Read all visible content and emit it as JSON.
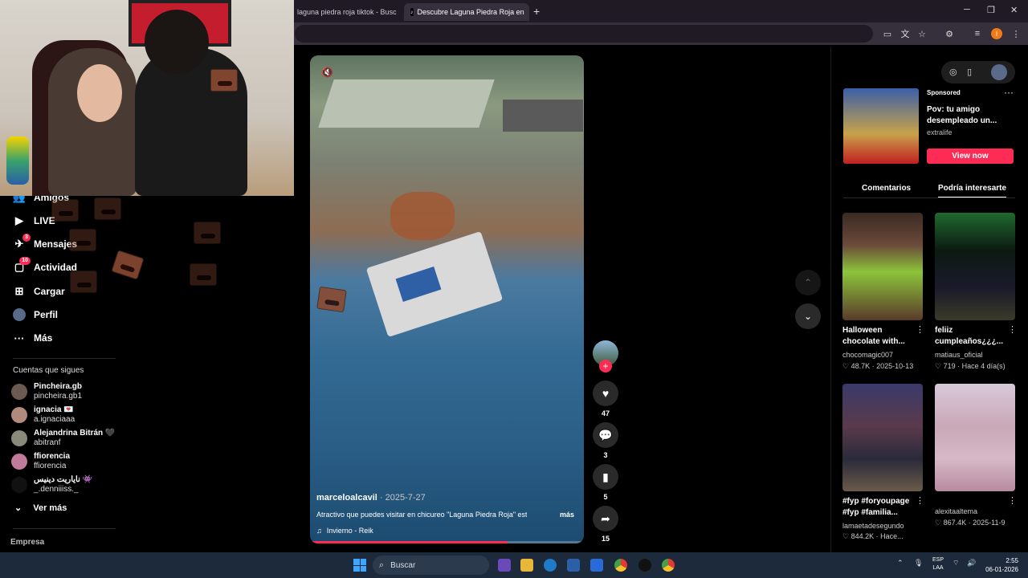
{
  "browser": {
    "tabs": [
      {
        "title": "laguna piedra roja tiktok - Busc"
      },
      {
        "title": "Descubre Laguna Piedra Roja en"
      }
    ],
    "new_tab": "+",
    "close": "×"
  },
  "sidebar": {
    "items": [
      {
        "label": "Amigos",
        "icon": "friends-icon"
      },
      {
        "label": "LIVE",
        "icon": "live-icon"
      },
      {
        "label": "Mensajes",
        "icon": "messages-icon",
        "badge": "3"
      },
      {
        "label": "Actividad",
        "icon": "activity-icon",
        "badge": "10"
      },
      {
        "label": "Cargar",
        "icon": "upload-icon"
      },
      {
        "label": "Perfil",
        "icon": "profile-icon"
      },
      {
        "label": "Más",
        "icon": "more-icon"
      }
    ],
    "following_heading": "Cuentas que sigues",
    "following": [
      {
        "name": "Pincheira.gb",
        "handle": "pincheira.gb1"
      },
      {
        "name": "ignacia 💌",
        "handle": "a.ignaciaaa"
      },
      {
        "name": "Alejandrina Bitrán 🖤",
        "handle": "abitranf"
      },
      {
        "name": "ffiorencia",
        "handle": "ffiorencia"
      },
      {
        "name": "نایاریت دینیس 👾",
        "handle": "_.denniiiss._"
      }
    ],
    "see_more": "Ver más",
    "footer": "Empresa"
  },
  "video": {
    "username": "marceloalcavil",
    "date": "2025-7-27",
    "caption": "Atractivo que puedes visitar en chicureo \"Laguna Piedra Roja\" está",
    "more": "más",
    "music": "Invierno - Reik",
    "progress": 0.72
  },
  "actions": {
    "likes": "47",
    "comments": "3",
    "saves": "5",
    "shares": "15"
  },
  "ad": {
    "sponsored": "Sponsored",
    "title": "Pov: tu amigo desempleado un...",
    "brand": "extralife",
    "cta": "View now"
  },
  "right_tabs": [
    "Comentarios",
    "Podría interesarte"
  ],
  "recommended": [
    {
      "title": "Halloween chocolate with...",
      "user": "chocomagic007",
      "likes": "48.7K",
      "date": "2025-10-13"
    },
    {
      "title": "feliiz cumpleaños¿¿¿...",
      "user": "matiaus_oficial",
      "likes": "719",
      "date": "Hace 4 día(s)"
    },
    {
      "title": "#fyp #foryoupage #fyp #familia...",
      "user": "lamaetadesegundo",
      "likes": "844.2K",
      "date": "Hace..."
    },
    {
      "title": "",
      "user": "alexitaaltema",
      "likes": "867.4K",
      "date": "2025-11-9"
    }
  ],
  "taskbar": {
    "search_placeholder": "Buscar",
    "lang_line1": "ESP",
    "lang_line2": "LAA",
    "time": "2:55",
    "date": "06-01-2026"
  },
  "colors": {
    "accent": "#fe2c55",
    "background": "#000000",
    "taskbar": "#1d2a3c"
  }
}
